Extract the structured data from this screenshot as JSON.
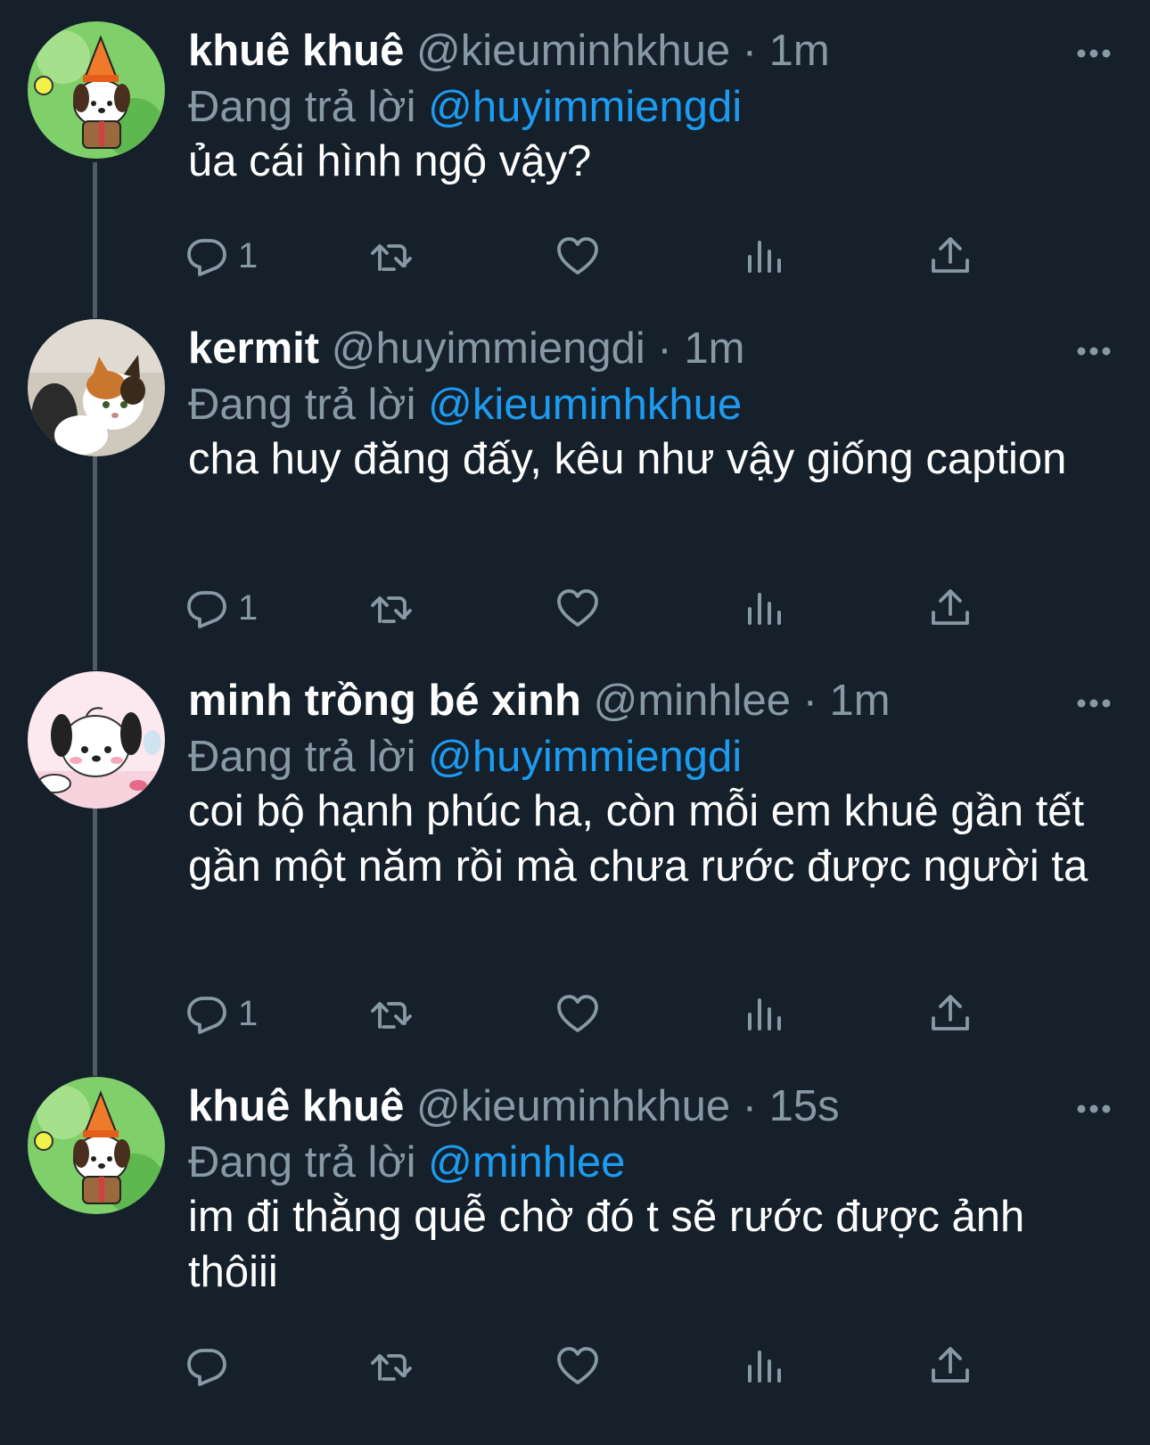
{
  "tweets": [
    {
      "name": "khuê khuê",
      "handle": "@kieuminhkhue",
      "time": "1m",
      "replying_prefix": "Đang trả lời",
      "replying_to": "@huyimmiengdi",
      "text": "ủa cái hình ngộ vậy?",
      "reply_count": "1",
      "avatar_icon": "pochacco-traffic-cone-avatar"
    },
    {
      "name": "kermit",
      "handle": "@huyimmiengdi",
      "time": "1m",
      "replying_prefix": "Đang trả lời",
      "replying_to": "@kieuminhkhue",
      "text": "cha huy đăng đấy, kêu như vậy giống caption",
      "reply_count": "1",
      "avatar_icon": "calico-cat-avatar"
    },
    {
      "name": "minh trồng bé xinh",
      "handle": "@minhlee",
      "time": "1m",
      "replying_prefix": "Đang trả lời",
      "replying_to": "@huyimmiengdi",
      "text": "coi bộ hạnh phúc ha, còn mỗi em khuê gần tết gần một năm rồi mà chưa rước được người ta",
      "reply_count": "1",
      "avatar_icon": "pochacco-pink-avatar"
    },
    {
      "name": "khuê khuê",
      "handle": "@kieuminhkhue",
      "time": "15s",
      "replying_prefix": "Đang trả lời",
      "replying_to": "@minhlee",
      "text": "im đi thằng quễ chờ đó t sẽ rước được ảnh thôiii",
      "reply_count": "",
      "avatar_icon": "pochacco-traffic-cone-avatar"
    }
  ],
  "separator": "·",
  "colors": {
    "background": "#15202b",
    "text": "#ffffff",
    "muted": "#8899a6",
    "link": "#1d9bf0",
    "thread_line": "#4e5b69"
  },
  "icons": {
    "reply": "reply-icon",
    "retweet": "retweet-icon",
    "like": "heart-icon",
    "analytics": "analytics-icon",
    "share": "share-icon",
    "more": "more-icon"
  }
}
